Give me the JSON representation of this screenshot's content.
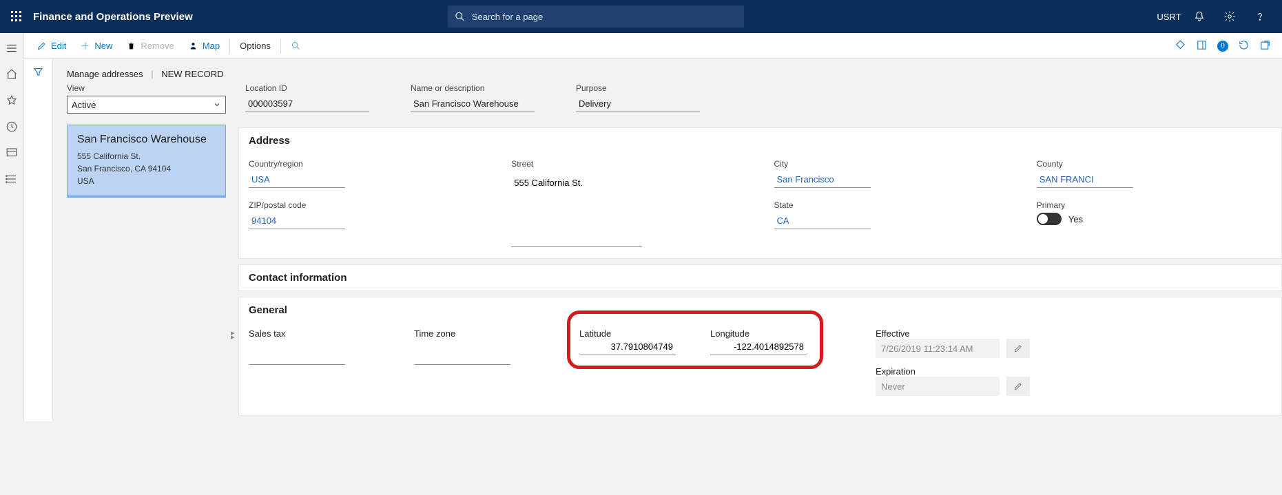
{
  "nav": {
    "app_title": "Finance and Operations Preview",
    "search_placeholder": "Search for a page",
    "company": "USRT"
  },
  "toolbar": {
    "edit": "Edit",
    "new": "New",
    "remove": "Remove",
    "map": "Map",
    "options": "Options",
    "attachments_count": "0"
  },
  "crumb": {
    "root": "Manage addresses",
    "current": "NEW RECORD"
  },
  "list": {
    "view_label": "View",
    "view_value": "Active",
    "card": {
      "title": "San Francisco Warehouse",
      "line1": "555 California St.",
      "line2": "San Francisco, CA 94104",
      "line3": "USA"
    }
  },
  "header_fields": {
    "location_id": {
      "label": "Location ID",
      "value": "000003597"
    },
    "name": {
      "label": "Name or description",
      "value": "San Francisco Warehouse"
    },
    "purpose": {
      "label": "Purpose",
      "value": "Delivery"
    }
  },
  "sections": {
    "address": {
      "title": "Address",
      "country": {
        "label": "Country/region",
        "value": "USA"
      },
      "zip": {
        "label": "ZIP/postal code",
        "value": "94104"
      },
      "street": {
        "label": "Street",
        "value": "555 California St."
      },
      "city": {
        "label": "City",
        "value": "San Francisco"
      },
      "state": {
        "label": "State",
        "value": "CA"
      },
      "county": {
        "label": "County",
        "value": "SAN FRANCI"
      },
      "primary": {
        "label": "Primary",
        "value": "Yes"
      }
    },
    "contact": {
      "title": "Contact information"
    },
    "general": {
      "title": "General",
      "sales_tax": {
        "label": "Sales tax",
        "value": ""
      },
      "time_zone": {
        "label": "Time zone",
        "value": ""
      },
      "latitude": {
        "label": "Latitude",
        "value": "37.7910804749"
      },
      "longitude": {
        "label": "Longitude",
        "value": "-122.4014892578"
      },
      "effective": {
        "label": "Effective",
        "value": "7/26/2019 11:23:14 AM"
      },
      "expiration": {
        "label": "Expiration",
        "value": "Never"
      }
    }
  }
}
